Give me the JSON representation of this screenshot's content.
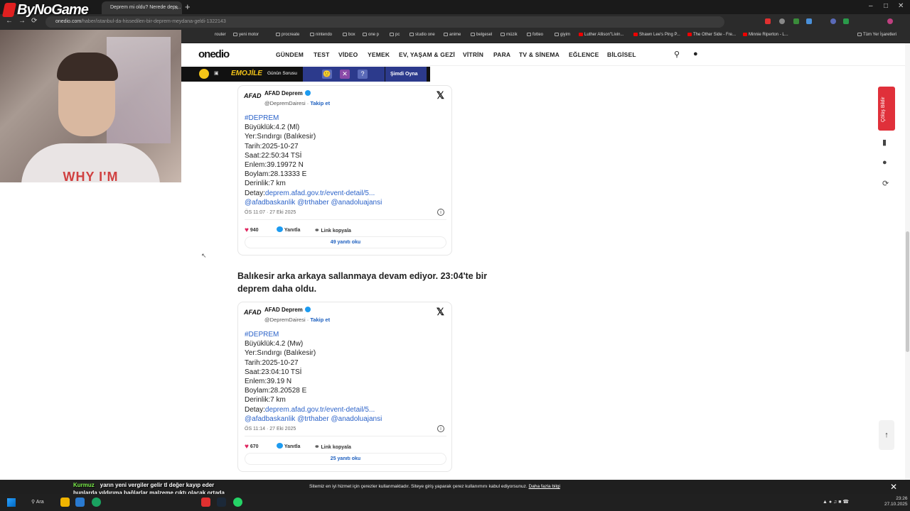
{
  "browser": {
    "tab_title": "Deprem mi oldu? Nerede depr...",
    "tab_close": "×",
    "new_tab": "+",
    "window_controls": [
      "–",
      "□",
      "✕"
    ],
    "nav": {
      "back": "←",
      "forward": "→",
      "reload": "⟳"
    },
    "url_host": "onedio.com",
    "url_path": "/haber/istanbul-da-hissedilen-bir-deprem-meydana-geldi-1322143",
    "bookmarks": [
      "router",
      "yeni motor",
      "procreate",
      "nintendo",
      "box",
      "one p",
      "pc",
      "studio one",
      "anime",
      "belgesel",
      "müzik",
      "fotteo",
      "giyim",
      "Luther Allison\"Livin...",
      "Shawn Lee's Ping P...",
      "The Other Side - Fre...",
      "Minnie Riperton - L...",
      "Tüm Yer İşaretleri"
    ]
  },
  "overlay": {
    "logo": "ByNoGame",
    "webcam_text": "WHY I'M"
  },
  "site": {
    "logo": "onedio",
    "nav": [
      "GÜNDEM",
      "TEST",
      "VİDEO",
      "YEMEK",
      "EV, YAŞAM & GEZİ",
      "VİTRİN",
      "PARA",
      "TV & SİNEMA",
      "EĞLENCE",
      "BİLGİSEL"
    ],
    "search_icon": "search-icon",
    "user_icon": "user-icon"
  },
  "promo": {
    "brand": "EMOJİLE",
    "question_label": "Günün Sorusu",
    "puzzle": [
      "🙂",
      "✕",
      "=",
      "?"
    ],
    "play_label": "Şimdi Oyna"
  },
  "side": {
    "bulletin": "Çölüş Bildir"
  },
  "tweets": [
    {
      "avatar_text": "AFAD",
      "name": "AFAD Deprem",
      "handle": "@DepremDairesi",
      "follow": "Takip et",
      "hashtag": "#DEPREM",
      "lines": [
        "Büyüklük:4.2 (Ml)",
        "Yer:Sındırgı (Balıkesir)",
        "Tarih:2025-10-27",
        "Saat:22:50:34 TSİ",
        "Enlem:39.19972 N",
        "Boylam:28.13333 E",
        "Derinlik:7 km"
      ],
      "detail_label": "Detay:",
      "detail_link": "deprem.afad.gov.tr/event-detail/5...",
      "mentions": "@afadbaskanlik @trthaber @anadoluajansi",
      "time": "ÖS 11:07 · 27 Eki 2025",
      "likes": "940",
      "reply_label": "Yanıtla",
      "copy_label": "Link kopyala",
      "replies_label": "49 yanıtı oku"
    },
    {
      "avatar_text": "AFAD",
      "name": "AFAD Deprem",
      "handle": "@DepremDairesi",
      "follow": "Takip et",
      "hashtag": "#DEPREM",
      "lines": [
        "Büyüklük:4.2 (Mw)",
        "Yer:Sındırgı (Balıkesir)",
        "Tarih:2025-10-27",
        "Saat:23:04:10 TSİ",
        "Enlem:39.19 N",
        "Boylam:28.20528 E",
        "Derinlik:7 km"
      ],
      "detail_label": "Detay:",
      "detail_link": "deprem.afad.gov.tr/event-detail/5...",
      "mentions": "@afadbaskanlik @trthaber @anadoluajansi",
      "time": "ÖS 11:14 · 27 Eki 2025",
      "likes": "670",
      "reply_label": "Yanıtla",
      "copy_label": "Link kopyala",
      "replies_label": "25 yanıtı oku"
    }
  ],
  "article": {
    "heading2": "Balıkesir arka arkaya sallanmaya devam ediyor. 23:04'te bir deprem daha oldu."
  },
  "cookie": {
    "message": "Sitemiz en iyi hizmet için çerezler kullanmaktadır. Siteye giriş yaparak çerez kullanımını kabul ediyorsunuz.",
    "link": "Daha fazla bilgi",
    "close": "✕"
  },
  "chat": {
    "user": "Kurmuz",
    "message": "yarın yeni vergiler gelir tl değer kayıp eder bunlarda yıldırıma bağlarlar malzeme çıktı olacak ortada skedi gibi sikeyiz"
  },
  "taskbar": {
    "search": "Ara",
    "time": "23:26",
    "date": "27.10.2025"
  },
  "colors": {
    "accent": "#e0303a",
    "link": "#2c63c9",
    "twitter_blue": "#1d9bf0"
  }
}
